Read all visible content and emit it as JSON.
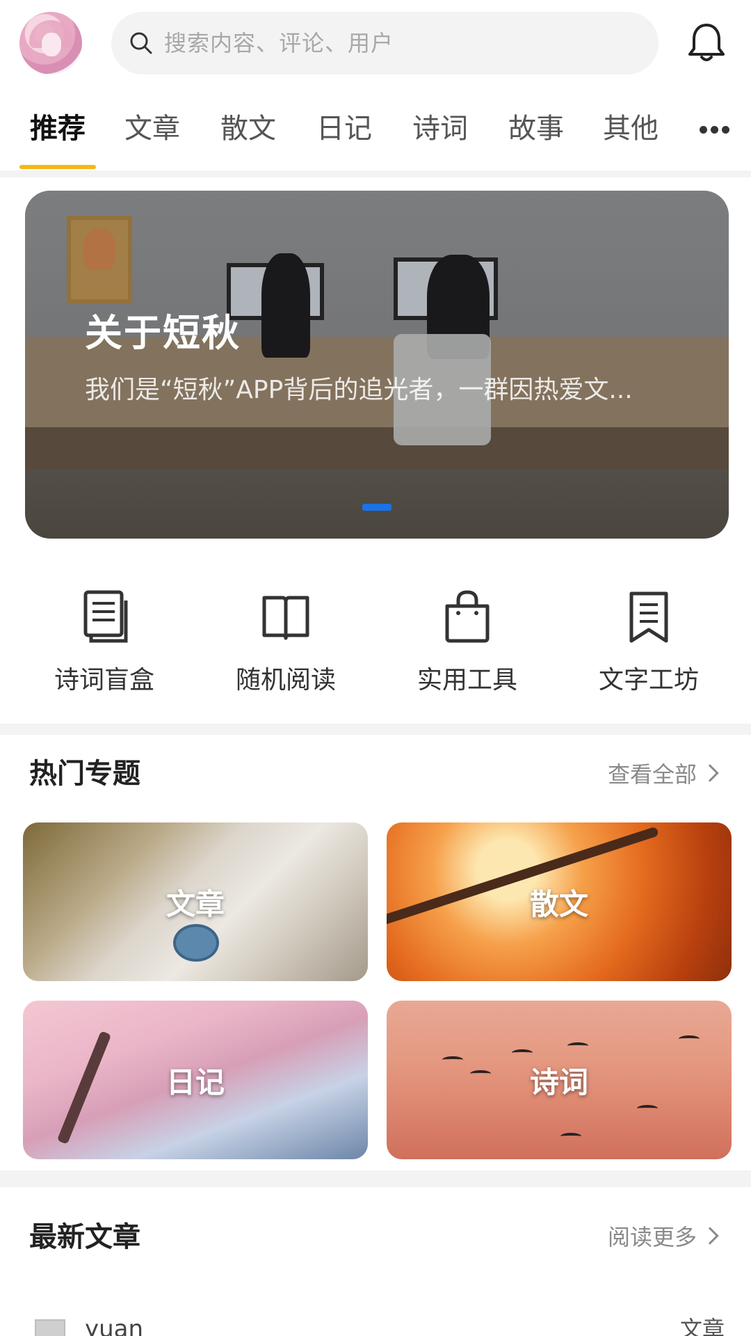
{
  "header": {
    "avatar_alt": "user avatar",
    "search": {
      "placeholder": "搜索内容、评论、用户"
    }
  },
  "tabs": [
    {
      "label": "推荐",
      "active": true
    },
    {
      "label": "文章",
      "active": false
    },
    {
      "label": "散文",
      "active": false
    },
    {
      "label": "日记",
      "active": false
    },
    {
      "label": "诗词",
      "active": false
    },
    {
      "label": "故事",
      "active": false
    },
    {
      "label": "其他",
      "active": false
    }
  ],
  "banner": {
    "title": "关于短秋",
    "subtitle": "我们是“短秋”APP背后的追光者，一群因热爱文...",
    "page_index": 1,
    "page_count": 1
  },
  "quick_actions": [
    {
      "label": "诗词盲盒",
      "icon": "document-icon"
    },
    {
      "label": "随机阅读",
      "icon": "open-book-icon"
    },
    {
      "label": "实用工具",
      "icon": "bag-icon"
    },
    {
      "label": "文字工坊",
      "icon": "bookmark-icon"
    }
  ],
  "hot_topics": {
    "title": "热门专题",
    "more_label": "查看全部",
    "items": [
      {
        "label": "文章"
      },
      {
        "label": "散文"
      },
      {
        "label": "日记"
      },
      {
        "label": "诗词"
      }
    ]
  },
  "latest_articles": {
    "title": "最新文章",
    "more_label": "阅读更多",
    "items": [
      {
        "author": "yuan",
        "category": "文章"
      }
    ]
  },
  "colors": {
    "accent": "#f5b819",
    "indicator": "#1a73e8",
    "divider": "#f3f3f3"
  }
}
